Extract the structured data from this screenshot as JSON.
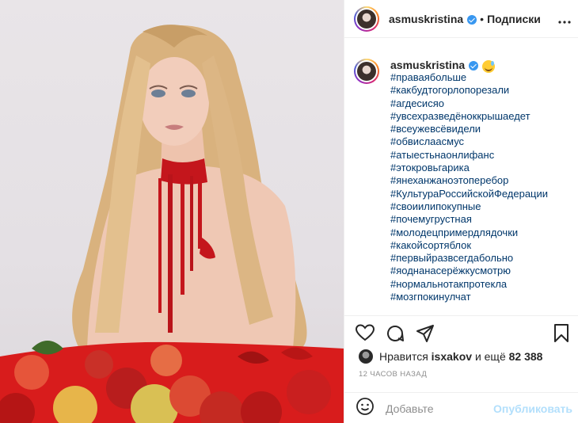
{
  "header": {
    "username": "asmuskristina",
    "separator": "•",
    "follow_label": "Подписки"
  },
  "caption": {
    "username": "asmuskristina",
    "hashtags": [
      "#праваябольше",
      "#какбудтогорлопорезали",
      "#агдесисяо",
      "#увсехразведёноккрышаедет",
      "#всеужевсёвидели",
      "#обвислаасмус",
      "#атыестьнаонлифанс",
      "#этокровьгарика",
      "#янеханжаноэтоперебор",
      "#КультураРоссийскойФедерации",
      "#своиилипокупные",
      "#почемугрустная",
      "#молодецпримердлядочки",
      "#какойсортяблок",
      "#первыйразвсегдабольно",
      "#яоднанасерёжкусмотрю",
      "#нормальнотакпротекла",
      "#мозгпокинулчат"
    ]
  },
  "likes": {
    "prefix": "Нравится",
    "user": "isxakov",
    "middle": "и ещё",
    "count": "82 388"
  },
  "timestamp": "12 ЧАСОВ НАЗАД",
  "comment": {
    "placeholder": "Добавьте",
    "post_label": "Опубликовать"
  },
  "colors": {
    "verified": "#3897f0",
    "hashtag": "#00376b",
    "post_disabled": "#b2dffc",
    "table_red": "#d81c1c"
  },
  "icons": [
    "verified-badge-icon",
    "more-options-icon",
    "emoji-icon",
    "heart-icon",
    "comment-icon",
    "share-icon",
    "bookmark-icon",
    "smiley-icon"
  ]
}
